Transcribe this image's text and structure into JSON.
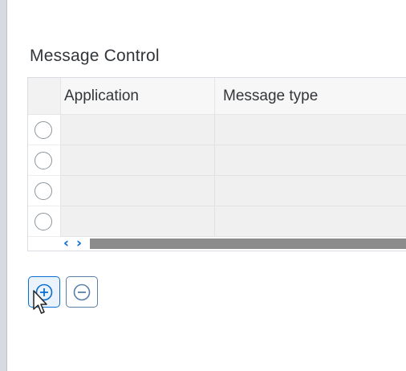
{
  "section": {
    "title": "Message Control"
  },
  "table": {
    "columns": [
      "Application",
      "Message type"
    ],
    "rows": [
      {
        "application": "",
        "message_type": ""
      },
      {
        "application": "",
        "message_type": ""
      },
      {
        "application": "",
        "message_type": ""
      },
      {
        "application": "",
        "message_type": ""
      }
    ]
  },
  "scroll": {
    "left_glyph": "‹",
    "right_glyph": "›"
  },
  "buttons": {
    "add_icon": "add-circle-icon",
    "remove_icon": "remove-circle-icon"
  },
  "colors": {
    "accent": "#0a6ed1",
    "row_fill": "#f0f0f0",
    "scroll_thumb": "#8c8c8c"
  }
}
